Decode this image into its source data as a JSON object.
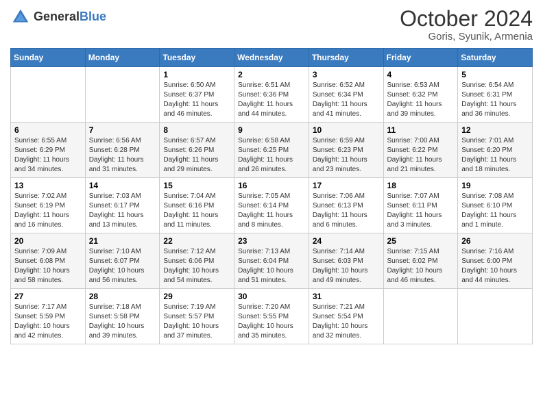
{
  "header": {
    "logo_general": "General",
    "logo_blue": "Blue",
    "month": "October 2024",
    "location": "Goris, Syunik, Armenia"
  },
  "weekdays": [
    "Sunday",
    "Monday",
    "Tuesday",
    "Wednesday",
    "Thursday",
    "Friday",
    "Saturday"
  ],
  "weeks": [
    [
      {
        "day": "",
        "info": ""
      },
      {
        "day": "",
        "info": ""
      },
      {
        "day": "1",
        "info": "Sunrise: 6:50 AM\nSunset: 6:37 PM\nDaylight: 11 hours and 46 minutes."
      },
      {
        "day": "2",
        "info": "Sunrise: 6:51 AM\nSunset: 6:36 PM\nDaylight: 11 hours and 44 minutes."
      },
      {
        "day": "3",
        "info": "Sunrise: 6:52 AM\nSunset: 6:34 PM\nDaylight: 11 hours and 41 minutes."
      },
      {
        "day": "4",
        "info": "Sunrise: 6:53 AM\nSunset: 6:32 PM\nDaylight: 11 hours and 39 minutes."
      },
      {
        "day": "5",
        "info": "Sunrise: 6:54 AM\nSunset: 6:31 PM\nDaylight: 11 hours and 36 minutes."
      }
    ],
    [
      {
        "day": "6",
        "info": "Sunrise: 6:55 AM\nSunset: 6:29 PM\nDaylight: 11 hours and 34 minutes."
      },
      {
        "day": "7",
        "info": "Sunrise: 6:56 AM\nSunset: 6:28 PM\nDaylight: 11 hours and 31 minutes."
      },
      {
        "day": "8",
        "info": "Sunrise: 6:57 AM\nSunset: 6:26 PM\nDaylight: 11 hours and 29 minutes."
      },
      {
        "day": "9",
        "info": "Sunrise: 6:58 AM\nSunset: 6:25 PM\nDaylight: 11 hours and 26 minutes."
      },
      {
        "day": "10",
        "info": "Sunrise: 6:59 AM\nSunset: 6:23 PM\nDaylight: 11 hours and 23 minutes."
      },
      {
        "day": "11",
        "info": "Sunrise: 7:00 AM\nSunset: 6:22 PM\nDaylight: 11 hours and 21 minutes."
      },
      {
        "day": "12",
        "info": "Sunrise: 7:01 AM\nSunset: 6:20 PM\nDaylight: 11 hours and 18 minutes."
      }
    ],
    [
      {
        "day": "13",
        "info": "Sunrise: 7:02 AM\nSunset: 6:19 PM\nDaylight: 11 hours and 16 minutes."
      },
      {
        "day": "14",
        "info": "Sunrise: 7:03 AM\nSunset: 6:17 PM\nDaylight: 11 hours and 13 minutes."
      },
      {
        "day": "15",
        "info": "Sunrise: 7:04 AM\nSunset: 6:16 PM\nDaylight: 11 hours and 11 minutes."
      },
      {
        "day": "16",
        "info": "Sunrise: 7:05 AM\nSunset: 6:14 PM\nDaylight: 11 hours and 8 minutes."
      },
      {
        "day": "17",
        "info": "Sunrise: 7:06 AM\nSunset: 6:13 PM\nDaylight: 11 hours and 6 minutes."
      },
      {
        "day": "18",
        "info": "Sunrise: 7:07 AM\nSunset: 6:11 PM\nDaylight: 11 hours and 3 minutes."
      },
      {
        "day": "19",
        "info": "Sunrise: 7:08 AM\nSunset: 6:10 PM\nDaylight: 11 hours and 1 minute."
      }
    ],
    [
      {
        "day": "20",
        "info": "Sunrise: 7:09 AM\nSunset: 6:08 PM\nDaylight: 10 hours and 58 minutes."
      },
      {
        "day": "21",
        "info": "Sunrise: 7:10 AM\nSunset: 6:07 PM\nDaylight: 10 hours and 56 minutes."
      },
      {
        "day": "22",
        "info": "Sunrise: 7:12 AM\nSunset: 6:06 PM\nDaylight: 10 hours and 54 minutes."
      },
      {
        "day": "23",
        "info": "Sunrise: 7:13 AM\nSunset: 6:04 PM\nDaylight: 10 hours and 51 minutes."
      },
      {
        "day": "24",
        "info": "Sunrise: 7:14 AM\nSunset: 6:03 PM\nDaylight: 10 hours and 49 minutes."
      },
      {
        "day": "25",
        "info": "Sunrise: 7:15 AM\nSunset: 6:02 PM\nDaylight: 10 hours and 46 minutes."
      },
      {
        "day": "26",
        "info": "Sunrise: 7:16 AM\nSunset: 6:00 PM\nDaylight: 10 hours and 44 minutes."
      }
    ],
    [
      {
        "day": "27",
        "info": "Sunrise: 7:17 AM\nSunset: 5:59 PM\nDaylight: 10 hours and 42 minutes."
      },
      {
        "day": "28",
        "info": "Sunrise: 7:18 AM\nSunset: 5:58 PM\nDaylight: 10 hours and 39 minutes."
      },
      {
        "day": "29",
        "info": "Sunrise: 7:19 AM\nSunset: 5:57 PM\nDaylight: 10 hours and 37 minutes."
      },
      {
        "day": "30",
        "info": "Sunrise: 7:20 AM\nSunset: 5:55 PM\nDaylight: 10 hours and 35 minutes."
      },
      {
        "day": "31",
        "info": "Sunrise: 7:21 AM\nSunset: 5:54 PM\nDaylight: 10 hours and 32 minutes."
      },
      {
        "day": "",
        "info": ""
      },
      {
        "day": "",
        "info": ""
      }
    ]
  ]
}
